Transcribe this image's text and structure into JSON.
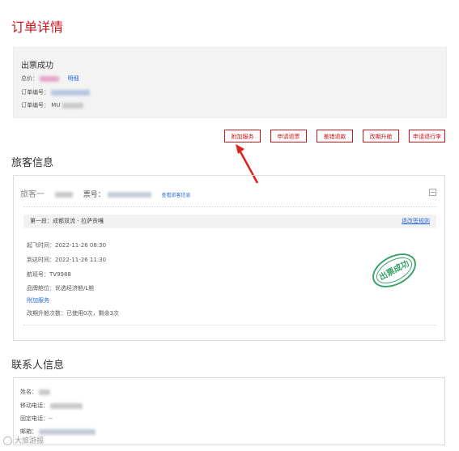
{
  "page": {
    "title": "订单详情"
  },
  "order_status": {
    "status_text": "出票成功",
    "total_label": "总价：",
    "detail_link": "明细",
    "order_no_label": "订单编号：",
    "order_no_value_prefix": "",
    "order_no2_label": "订单编号：",
    "order_no2_value_prefix": "MU"
  },
  "actions": [
    {
      "label": "附加服务"
    },
    {
      "label": "申请退票"
    },
    {
      "label": "差错退款"
    },
    {
      "label": "改期升舱"
    },
    {
      "label": "申请退行李"
    }
  ],
  "passenger_section": {
    "title": "旅客信息",
    "passenger_label": "旅客一",
    "ticket_label": "票号：",
    "view_info_link": "查看旅客信息",
    "segment": {
      "label": "第一段：成都双流 - 拉萨贡嘎",
      "rules_link": "退改签规则"
    },
    "flight": {
      "depart_label": "起飞时间：",
      "depart_time": "2022-11-26 08:30",
      "arrive_label": "到达时间：",
      "arrive_time": "2022-11-26 11:30",
      "flight_no_label": "航班号：",
      "flight_no": "TV9988",
      "cabin_label": "品牌舱位：",
      "cabin": "优选经济舱/L舱",
      "addon_link": "附加服务",
      "upgrade_label": "改期升舱次数：",
      "upgrade_value": "已使用0次，剩余3次"
    },
    "stamp_text": "出票成功"
  },
  "contact_section": {
    "title": "联系人信息",
    "name_label": "姓名：",
    "mobile_label": "移动电话：",
    "phone_label": "固定电话：",
    "phone_value": "--",
    "email_label": "邮箱："
  },
  "watermark": {
    "text": "大旅游报"
  },
  "colors": {
    "accent": "#c8161d",
    "link": "#2a6bd8",
    "stamp": "#3aa36a"
  }
}
